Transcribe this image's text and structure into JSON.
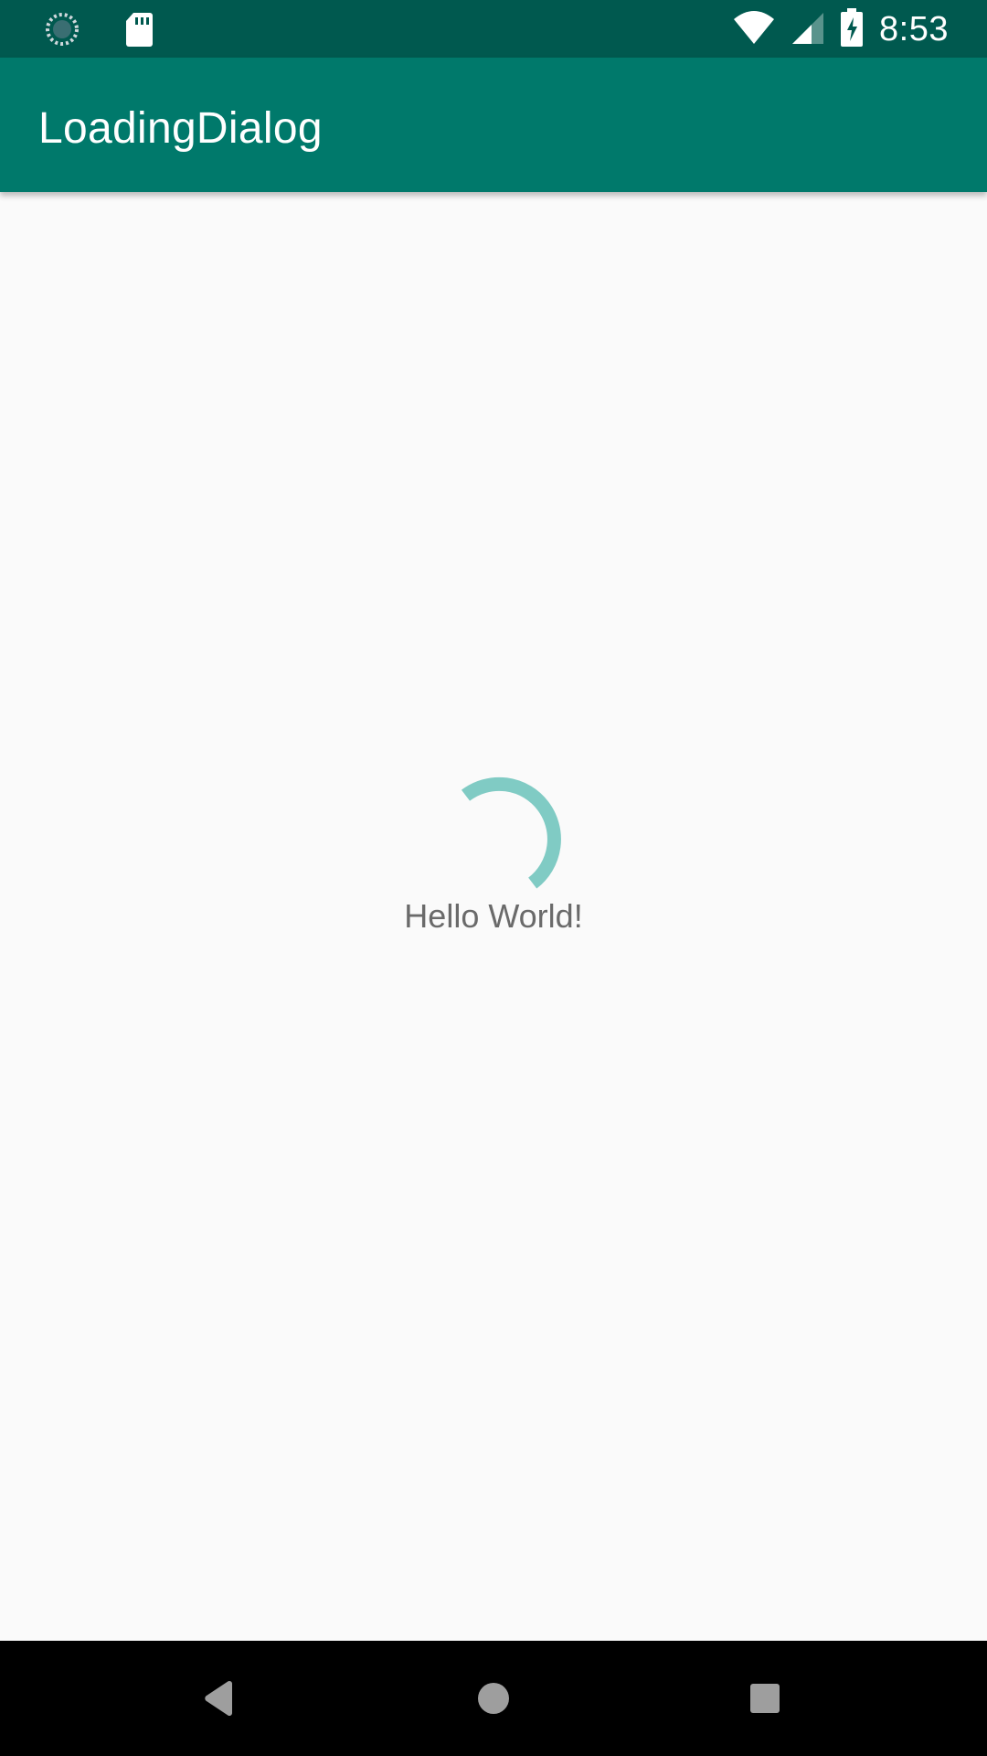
{
  "status_bar": {
    "time": "8:53",
    "icons": [
      "loading-circle-icon",
      "sd-card-icon",
      "wifi-icon",
      "signal-icon",
      "battery-charging-icon"
    ]
  },
  "app_bar": {
    "title": "LoadingDialog"
  },
  "content": {
    "hello_text": "Hello World!",
    "spinner_color": "#80cbc4"
  },
  "nav_bar": {
    "buttons": [
      "back-icon",
      "home-icon",
      "recents-icon"
    ]
  },
  "colors": {
    "status_bar": "#00594f",
    "app_bar": "#00796b",
    "background": "#fafafa",
    "accent": "#80cbc4"
  }
}
